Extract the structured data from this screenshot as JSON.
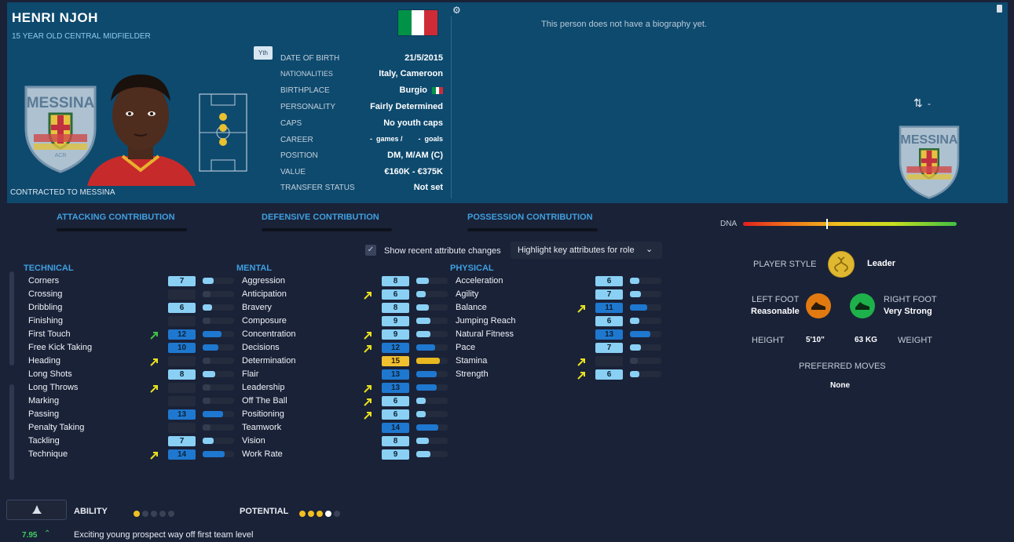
{
  "player": {
    "name": "HENRI NJOH",
    "subtitle": "15 YEAR OLD  CENTRAL MIDFIELDER",
    "contract": "CONTRACTED TO MESSINA",
    "youth_badge": "Yth",
    "club_badge_text": "MESSINA",
    "club_badge_sub": "ACR",
    "bio": "This person does not have a biography yet.",
    "flag_colors": [
      "#009246",
      "#ffffff",
      "#ce2b37"
    ],
    "transfer_icon_label": "-"
  },
  "info": {
    "rows": [
      {
        "label": "DATE OF BIRTH",
        "value": "21/5/2015"
      },
      {
        "label": "NATIONALITIES",
        "value": "Italy, Cameroon"
      },
      {
        "label": "BIRTHPLACE",
        "value": "Burgio"
      },
      {
        "label": "PERSONALITY",
        "value": "Fairly Determined"
      },
      {
        "label": "CAPS",
        "value": "No youth caps"
      },
      {
        "label": "CAREER",
        "value": "-  games /        -  goals"
      },
      {
        "label": "POSITION",
        "value": "DM, M/AM (C)"
      },
      {
        "label": "VALUE",
        "value": "€160K - €375K"
      },
      {
        "label": "TRANSFER STATUS",
        "value": "Not set"
      }
    ]
  },
  "contribution": {
    "attacking": "ATTACKING CONTRIBUTION",
    "defensive": "DEFENSIVE CONTRIBUTION",
    "possession": "POSSESSION CONTRIBUTION"
  },
  "controls": {
    "show_changes": "Show recent attribute changes",
    "highlight": "Highlight key attributes for role"
  },
  "sections": {
    "technical": "TECHNICAL",
    "mental": "MENTAL",
    "physical": "PHYSICAL"
  },
  "technical": [
    {
      "name": "Corners",
      "value": "7",
      "level": 7,
      "arrow": ""
    },
    {
      "name": "Crossing",
      "value": "",
      "level": 0,
      "arrow": ""
    },
    {
      "name": "Dribbling",
      "value": "6",
      "level": 6,
      "arrow": ""
    },
    {
      "name": "Finishing",
      "value": "",
      "level": 0,
      "arrow": ""
    },
    {
      "name": "First Touch",
      "value": "12",
      "level": 12,
      "arrow": "up-green"
    },
    {
      "name": "Free Kick Taking",
      "value": "10",
      "level": 10,
      "arrow": ""
    },
    {
      "name": "Heading",
      "value": "",
      "level": 0,
      "arrow": "up-yellow"
    },
    {
      "name": "Long Shots",
      "value": "8",
      "level": 8,
      "arrow": ""
    },
    {
      "name": "Long Throws",
      "value": "",
      "level": 0,
      "arrow": "up-yellow"
    },
    {
      "name": "Marking",
      "value": "",
      "level": 0,
      "arrow": ""
    },
    {
      "name": "Passing",
      "value": "13",
      "level": 13,
      "arrow": ""
    },
    {
      "name": "Penalty Taking",
      "value": "",
      "level": 0,
      "arrow": ""
    },
    {
      "name": "Tackling",
      "value": "7",
      "level": 7,
      "arrow": ""
    },
    {
      "name": "Technique",
      "value": "14",
      "level": 14,
      "arrow": "up-yellow"
    }
  ],
  "mental": [
    {
      "name": "Aggression",
      "value": "8",
      "level": 8,
      "arrow": ""
    },
    {
      "name": "Anticipation",
      "value": "6",
      "level": 6,
      "arrow": "up-yellow"
    },
    {
      "name": "Bravery",
      "value": "8",
      "level": 8,
      "arrow": ""
    },
    {
      "name": "Composure",
      "value": "9",
      "level": 9,
      "arrow": ""
    },
    {
      "name": "Concentration",
      "value": "9",
      "level": 9,
      "arrow": "up-yellow"
    },
    {
      "name": "Decisions",
      "value": "12",
      "level": 12,
      "arrow": "up-yellow"
    },
    {
      "name": "Determination",
      "value": "15",
      "level": 15,
      "arrow": ""
    },
    {
      "name": "Flair",
      "value": "13",
      "level": 13,
      "arrow": ""
    },
    {
      "name": "Leadership",
      "value": "13",
      "level": 13,
      "arrow": "up-yellow"
    },
    {
      "name": "Off The Ball",
      "value": "6",
      "level": 6,
      "arrow": "up-yellow"
    },
    {
      "name": "Positioning",
      "value": "6",
      "level": 6,
      "arrow": "up-yellow"
    },
    {
      "name": "Teamwork",
      "value": "14",
      "level": 14,
      "arrow": ""
    },
    {
      "name": "Vision",
      "value": "8",
      "level": 8,
      "arrow": ""
    },
    {
      "name": "Work Rate",
      "value": "9",
      "level": 9,
      "arrow": ""
    }
  ],
  "physical": [
    {
      "name": "Acceleration",
      "value": "6",
      "level": 6,
      "arrow": ""
    },
    {
      "name": "Agility",
      "value": "7",
      "level": 7,
      "arrow": ""
    },
    {
      "name": "Balance",
      "value": "11",
      "level": 11,
      "arrow": "up-yellow"
    },
    {
      "name": "Jumping Reach",
      "value": "6",
      "level": 6,
      "arrow": ""
    },
    {
      "name": "Natural Fitness",
      "value": "13",
      "level": 13,
      "arrow": ""
    },
    {
      "name": "Pace",
      "value": "7",
      "level": 7,
      "arrow": ""
    },
    {
      "name": "Stamina",
      "value": "",
      "level": 0,
      "arrow": "up-yellow"
    },
    {
      "name": "Strength",
      "value": "6",
      "level": 6,
      "arrow": "up-yellow"
    }
  ],
  "profile": {
    "dna_label": "DNA",
    "dna_level": 0.39,
    "player_style_label": "PLAYER STYLE",
    "player_style_value": "Leader",
    "left_foot_label": "LEFT FOOT",
    "left_foot_value": "Reasonable",
    "right_foot_label": "RIGHT FOOT",
    "right_foot_value": "Very Strong",
    "height_label": "HEIGHT",
    "height_value": "5'10\"",
    "weight_value": "63 KG",
    "weight_label": "WEIGHT",
    "preferred_moves_label": "PREFERRED MOVES",
    "preferred_moves_value": "None"
  },
  "bottom": {
    "ability_label": "ABILITY",
    "ability_stars": 1,
    "potential_label": "POTENTIAL",
    "potential_stars": 3,
    "potential_half": 1,
    "rating": "7.95",
    "description": "Exciting young prospect way off first team level"
  }
}
